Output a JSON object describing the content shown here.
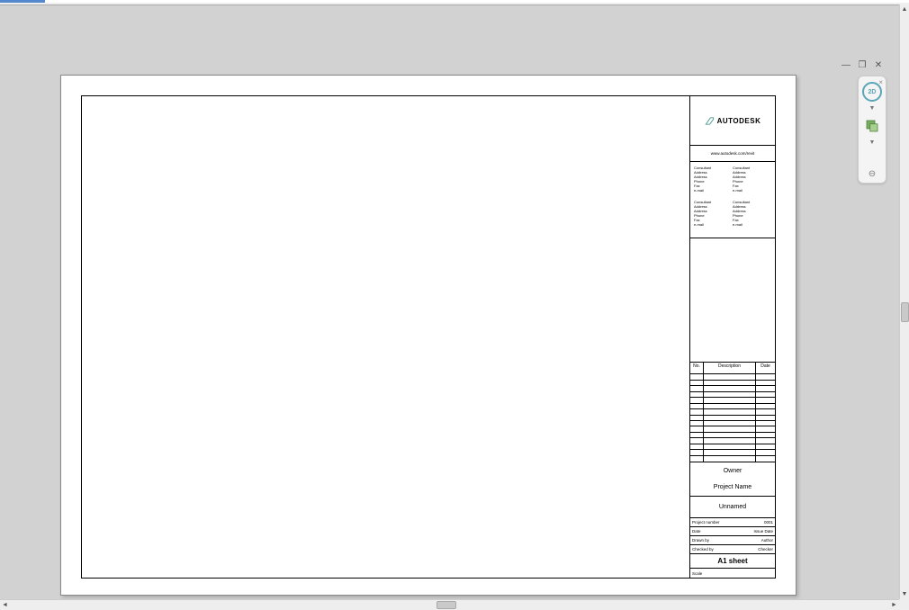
{
  "logo_text": "AUTODESK",
  "url_text": "www.autodesk.com/revit",
  "consultants": {
    "label_consultant": "Consultant",
    "label_address": "Address",
    "label_phone": "Phone",
    "label_fax": "Fax",
    "label_email": "e-mail"
  },
  "rev": {
    "no": "No.",
    "description": "Description",
    "date": "Date"
  },
  "owner": "Owner",
  "project_name": "Project Name",
  "view_name": "Unnamed",
  "kv": {
    "project_number_label": "Project number",
    "project_number": "0001",
    "date_label": "Date",
    "date": "Issue Date",
    "drawn_label": "Drawn by",
    "drawn": "Author",
    "checked_label": "Checked by",
    "checked": "Checker"
  },
  "sheet_number": "A1 sheet",
  "scale_label": "Scale",
  "nav": {
    "mode": "2D"
  }
}
